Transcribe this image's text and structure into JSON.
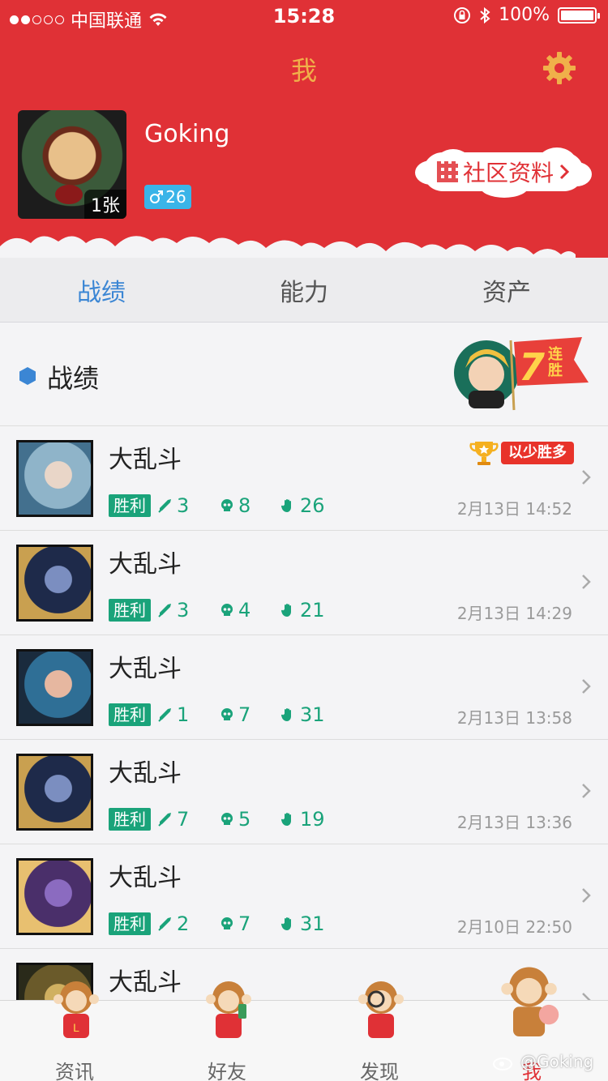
{
  "status_bar": {
    "carrier": "中国联通",
    "time": "15:28",
    "battery": "100%",
    "signal_bars_on": 2,
    "signal_bars_total": 5
  },
  "header": {
    "title": "我",
    "username": "Goking",
    "avatar_badge": "1张",
    "gender_level": "26",
    "community_label": "社区资料"
  },
  "tabs": [
    {
      "label": "战绩",
      "active": true
    },
    {
      "label": "能力",
      "active": false
    },
    {
      "label": "资产",
      "active": false
    }
  ],
  "section": {
    "title": "战绩",
    "streak_number": "7",
    "streak_text": "连胜"
  },
  "matches": [
    {
      "mode": "大乱斗",
      "result": "胜利",
      "kills": "3",
      "deaths": "8",
      "assists": "26",
      "time": "2月13日 14:52",
      "honor": "以少胜多",
      "hero_colors": [
        "#8fb4c9",
        "#e9d6c8",
        "#43708e"
      ]
    },
    {
      "mode": "大乱斗",
      "result": "胜利",
      "kills": "3",
      "deaths": "4",
      "assists": "21",
      "time": "2月13日 14:29",
      "honor": "",
      "hero_colors": [
        "#1e2a4a",
        "#7b8ec0",
        "#c9a050"
      ]
    },
    {
      "mode": "大乱斗",
      "result": "胜利",
      "kills": "1",
      "deaths": "7",
      "assists": "31",
      "time": "2月13日 13:58",
      "honor": "",
      "hero_colors": [
        "#2f6f96",
        "#e6b7a0",
        "#1a2b3d"
      ]
    },
    {
      "mode": "大乱斗",
      "result": "胜利",
      "kills": "7",
      "deaths": "5",
      "assists": "19",
      "time": "2月13日 13:36",
      "honor": "",
      "hero_colors": [
        "#1e2a4a",
        "#7b8ec0",
        "#c9a050"
      ]
    },
    {
      "mode": "大乱斗",
      "result": "胜利",
      "kills": "2",
      "deaths": "7",
      "assists": "31",
      "time": "2月10日 22:50",
      "honor": "",
      "hero_colors": [
        "#4a2f6a",
        "#8b6bc0",
        "#e8c070"
      ]
    },
    {
      "mode": "大乱斗",
      "result": "",
      "kills": "",
      "deaths": "",
      "assists": "",
      "time": "",
      "honor": "",
      "hero_colors": [
        "#6a5a2a",
        "#d0b060",
        "#2a2a1a"
      ]
    }
  ],
  "tabbar": [
    {
      "label": "资讯",
      "active": false
    },
    {
      "label": "好友",
      "active": false
    },
    {
      "label": "发现",
      "active": false
    },
    {
      "label": "我",
      "active": true
    }
  ],
  "watermark": "@Goking",
  "colors": {
    "brand_red": "#e03136",
    "win_green": "#1aa37a",
    "tab_active_blue": "#3b86d4"
  }
}
